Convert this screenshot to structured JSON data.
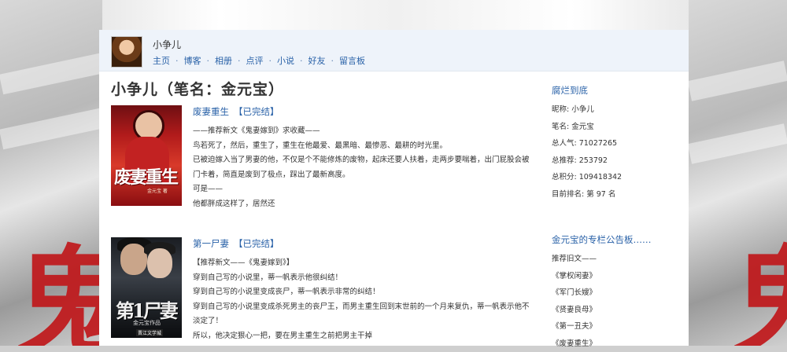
{
  "user": {
    "name": "小争儿",
    "nav": [
      "主页",
      "博客",
      "相册",
      "点评",
      "小说",
      "好友",
      "留言板"
    ],
    "nav_separator": "·"
  },
  "main": {
    "title": "小争儿（笔名：金元宝）",
    "books": [
      {
        "title": "废妻重生",
        "status": "【已完结】",
        "cover_text": "废妻重生",
        "cover_sub": "金元宝 著",
        "desc": [
          "——推荐新文《鬼妻嫁到》求收藏——",
          "鸟若死了，然后，重生了，重生在他最爱、最黑暗、最惨恶、最耕的时光里。",
          "已被迫嫁入当了男妻的他，不仅是个不能修炼的废物，起床还要人扶着，走两步要喘着，出门屁股会被门卡着，简直是废到了极点，踩出了最新高度。",
          "可是——",
          "他都胖成这样了，居然还"
        ]
      },
      {
        "title": "第一尸妻",
        "status": "【已完结】",
        "cover_text": "第1尸妻",
        "cover_sub": "金元宝作品",
        "cover_sub2": "晋江文学城",
        "desc": [
          "【推荐新文——《鬼妻嫁到》】",
          "穿到自己写的小说里，蒂一帆表示他很纠结！",
          "穿到自己写的小说里变成丧尸，蒂一帆表示非常的纠结！",
          "穿到自己写的小说里变成杀死男主的丧尸王，而男主重生回到末世前的一个月来复仇，蒂一帆表示他不淡定了！",
          "所以，他决定狠心一把，要在男主重生之前把男主干掉"
        ]
      }
    ]
  },
  "sidebar": {
    "title": "腐烂到底",
    "stats": [
      {
        "label": "昵称:",
        "value": "小争儿"
      },
      {
        "label": "笔名:",
        "value": "金元宝"
      },
      {
        "label": "总人气:",
        "value": "71027265"
      },
      {
        "label": "总推荐:",
        "value": "253792"
      },
      {
        "label": "总积分:",
        "value": "109418342"
      },
      {
        "label": "目前排名:",
        "value": "第 97 名"
      }
    ],
    "notice_title": "金元宝的专栏公告板……",
    "notice": [
      "推荐旧文——",
      "《掌权闲妻》",
      "《军门长嫂》",
      "《贤妻良母》",
      "《第一丑夫》",
      "《废妻重生》"
    ]
  },
  "background": {
    "ghost_char": "鬼",
    "accent": "#c0181b"
  },
  "colors": {
    "link": "#2a62a8",
    "header_bg": "#eef3fa"
  }
}
